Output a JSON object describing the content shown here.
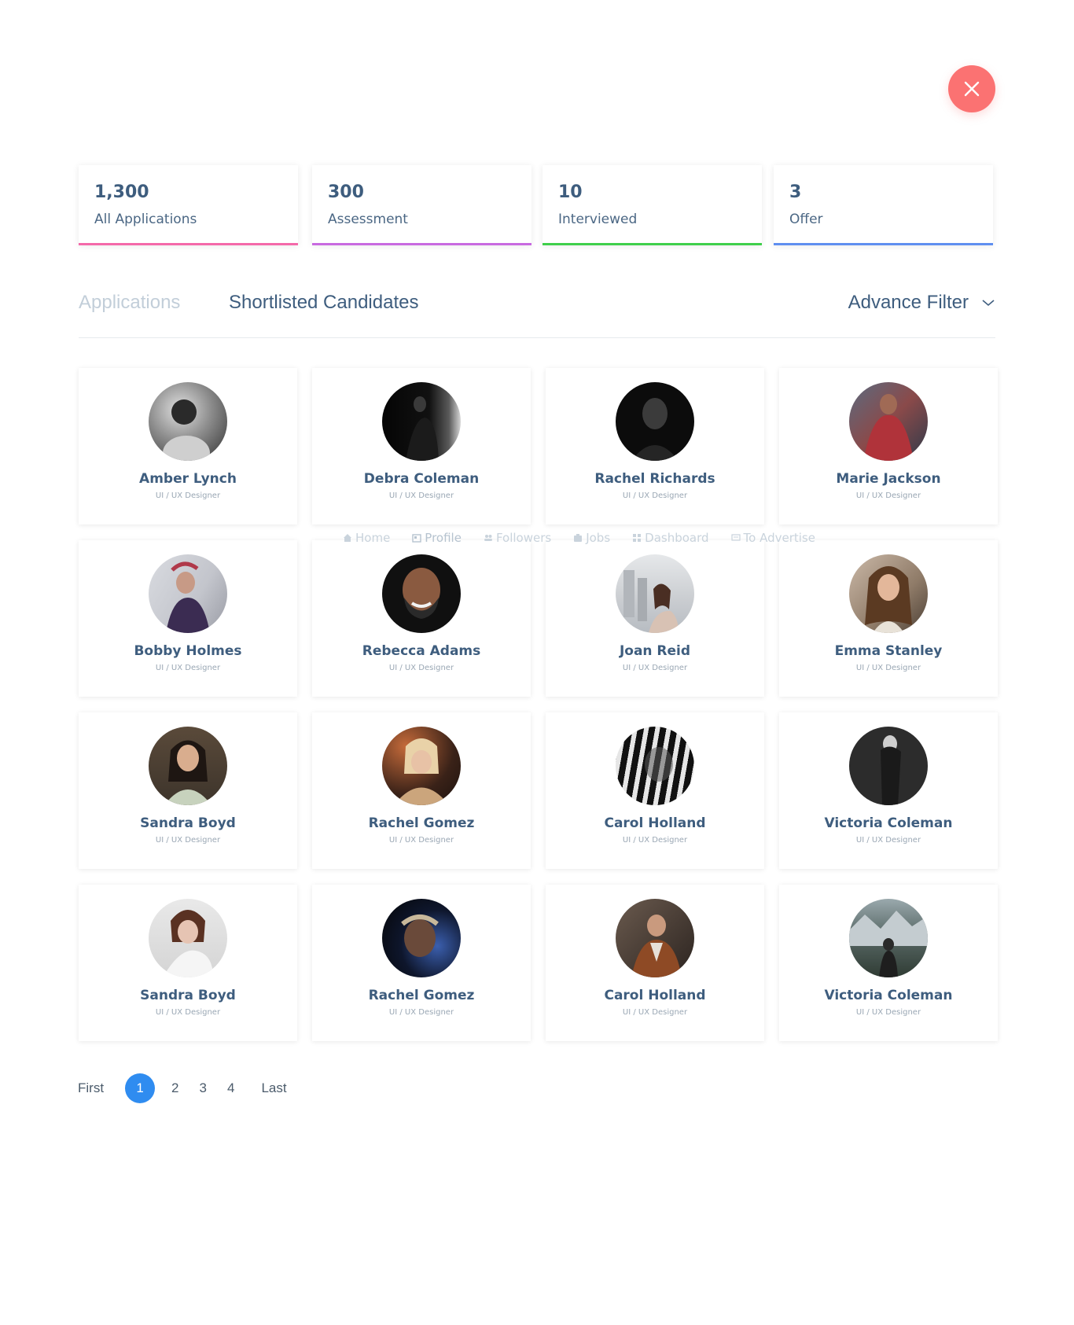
{
  "stats": [
    {
      "value": "1,300",
      "label": "All Applications",
      "color": "#f469a9"
    },
    {
      "value": "300",
      "label": "Assessment",
      "color": "#c86ae0"
    },
    {
      "value": "10",
      "label": "Interviewed",
      "color": "#3fcf4b"
    },
    {
      "value": "3",
      "label": "Offer",
      "color": "#5f8ff0"
    }
  ],
  "tabs": {
    "applications": "Applications",
    "shortlisted": "Shortlisted Candidates",
    "advance_filter": "Advance Filter"
  },
  "overlay_nav": {
    "home": "Home",
    "profile": "Profile",
    "followers": "Followers",
    "jobs": "Jobs",
    "dashboard": "Dashboard",
    "advertise": "To Advertise"
  },
  "candidates": [
    {
      "name": "Amber Lynch",
      "role": "UI / UX Designer"
    },
    {
      "name": "Debra Coleman",
      "role": "UI / UX Designer"
    },
    {
      "name": "Rachel Richards",
      "role": "UI / UX Designer"
    },
    {
      "name": "Marie Jackson",
      "role": "UI / UX Designer"
    },
    {
      "name": "Bobby Holmes",
      "role": "UI / UX Designer"
    },
    {
      "name": "Rebecca Adams",
      "role": "UI / UX Designer"
    },
    {
      "name": "Joan Reid",
      "role": "UI / UX Designer"
    },
    {
      "name": "Emma Stanley",
      "role": "UI / UX Designer"
    },
    {
      "name": "Sandra Boyd",
      "role": "UI / UX Designer"
    },
    {
      "name": "Rachel Gomez",
      "role": "UI / UX Designer"
    },
    {
      "name": "Carol Holland",
      "role": "UI / UX Designer"
    },
    {
      "name": "Victoria Coleman",
      "role": "UI / UX Designer"
    },
    {
      "name": "Sandra Boyd",
      "role": "UI / UX Designer"
    },
    {
      "name": "Rachel Gomez",
      "role": "UI / UX Designer"
    },
    {
      "name": "Carol Holland",
      "role": "UI / UX Designer"
    },
    {
      "name": "Victoria Coleman",
      "role": "UI / UX Designer"
    }
  ],
  "pagination": {
    "first": "First",
    "pages": [
      "1",
      "2",
      "3",
      "4"
    ],
    "last": "Last"
  },
  "colors": {
    "close_button": "#fb7272",
    "active_page": "#2f8cf0"
  }
}
